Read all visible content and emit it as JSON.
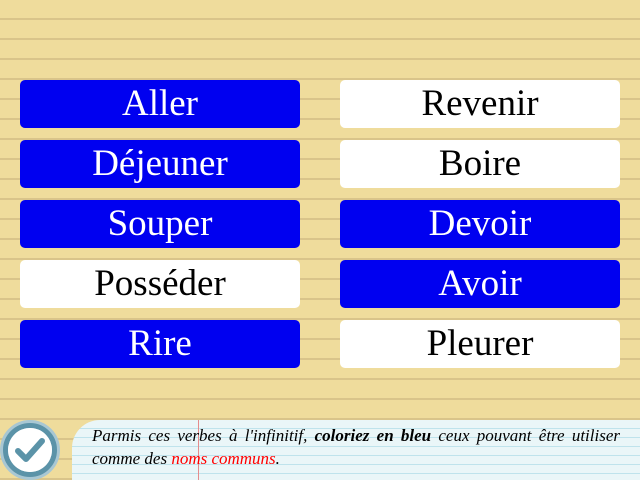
{
  "tiles": [
    {
      "label": "Aller",
      "color": "blue"
    },
    {
      "label": "Revenir",
      "color": "white"
    },
    {
      "label": "Déjeuner",
      "color": "blue"
    },
    {
      "label": "Boire",
      "color": "white"
    },
    {
      "label": "Souper",
      "color": "blue"
    },
    {
      "label": "Devoir",
      "color": "blue"
    },
    {
      "label": "Posséder",
      "color": "white"
    },
    {
      "label": "Avoir",
      "color": "blue"
    },
    {
      "label": "Rire",
      "color": "blue"
    },
    {
      "label": "Pleurer",
      "color": "white"
    }
  ],
  "instruction": {
    "part1": "Parmis ces verbes à l'infinitif, ",
    "bold": "coloriez en bleu",
    "part2": " ceux pouvant être utiliser comme des ",
    "red": "noms communs",
    "part3": "."
  },
  "check_button": {
    "icon": "checkmark-icon"
  },
  "colors": {
    "background": "#efdc9c",
    "blue_tile": "#0000f0",
    "white_tile": "#ffffff",
    "highlight_red": "#ff0000",
    "check_button": "#5b93a8"
  }
}
